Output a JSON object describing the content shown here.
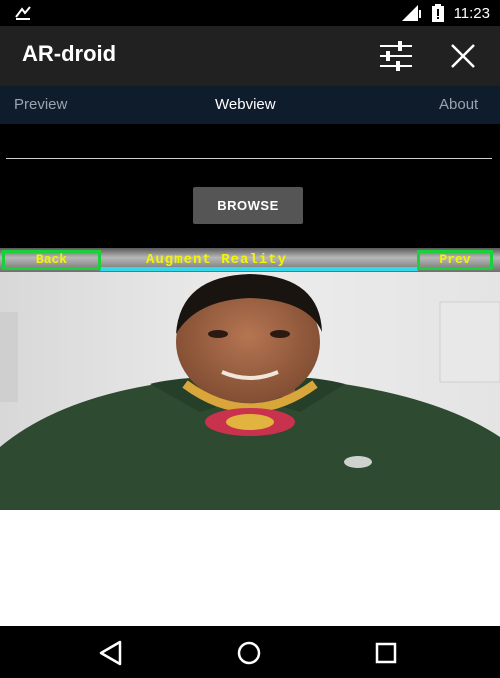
{
  "status_bar": {
    "time": "11:23",
    "icons": [
      "gesture-icon",
      "signal-icon",
      "battery-icon"
    ]
  },
  "app_bar": {
    "title": "AR-droid",
    "actions": [
      "tune-icon",
      "close-icon"
    ]
  },
  "tabs": [
    {
      "label": "Preview",
      "active": false
    },
    {
      "label": "Webview",
      "active": true
    },
    {
      "label": "About",
      "active": false
    }
  ],
  "content": {
    "url_value": "",
    "browse_label": "BROWSE"
  },
  "webview": {
    "back_label": "Back",
    "title": "Augment Reality",
    "prev_label": "Prev"
  },
  "nav_bar": {
    "buttons": [
      "back-triangle-icon",
      "home-circle-icon",
      "recents-square-icon"
    ]
  },
  "colors": {
    "app_bar": "#212121",
    "tab_bar": "#0f1c2c",
    "ar_button_border": "#19d23a",
    "ar_text": "#f5f500",
    "ar_line": "#35d8e8"
  }
}
